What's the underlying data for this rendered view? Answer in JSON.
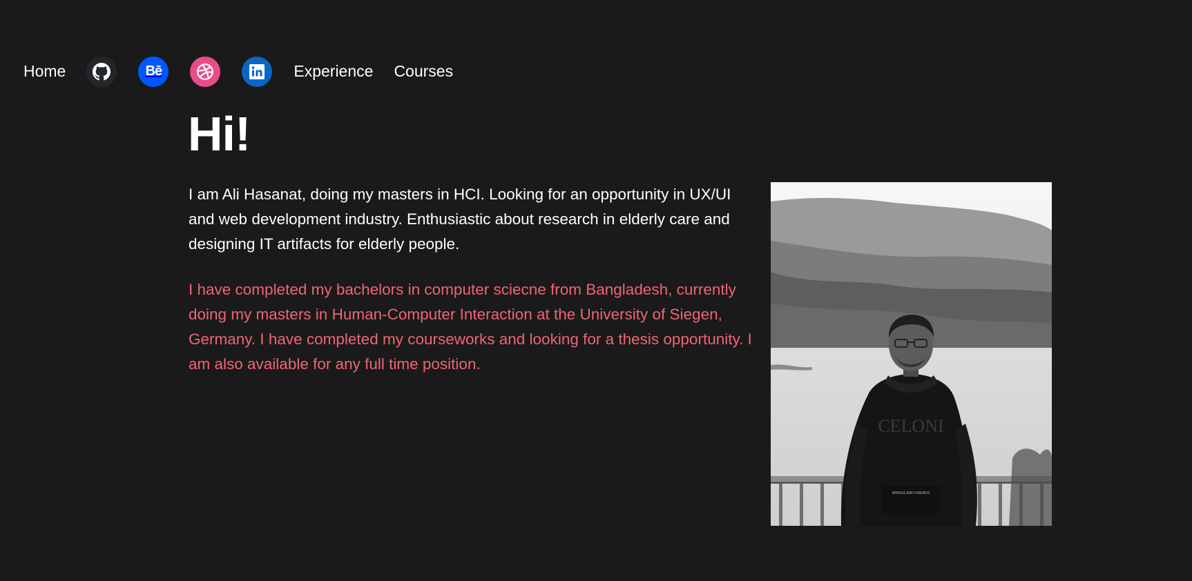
{
  "nav": {
    "home": "Home",
    "experience": "Experience",
    "courses": "Courses",
    "social": [
      {
        "name": "github",
        "icon": "github-icon",
        "color": "#23272b"
      },
      {
        "name": "behance",
        "icon": "behance-icon",
        "label": "Bē",
        "color": "#0057ff"
      },
      {
        "name": "dribbble",
        "icon": "dribbble-icon",
        "color": "#ea4c89"
      },
      {
        "name": "linkedin",
        "icon": "linkedin-icon",
        "color": "#0a66c2"
      }
    ]
  },
  "hero": {
    "greeting": "Hi!",
    "intro": "I am Ali Hasanat, doing my masters in HCI. Looking for an opportunity in UX/UI and web development industry. Enthusiastic about research in elderly care and designing IT artifacts for elderly people.",
    "bio": "I have completed my bachelors in computer sciecne from Bangladesh, currently doing my masters in Human-Computer Interaction at the University of Siegen, Germany. I have completed my courseworks and looking for a thesis opportunity. I am also available for any full time position.",
    "photo": {
      "hoodie_text": "CELONI",
      "pocket_text": "BRINGS AND FRIENDS"
    }
  },
  "colors": {
    "background": "#1a1a1a",
    "text": "#ffffff",
    "accent": "#f06574"
  }
}
